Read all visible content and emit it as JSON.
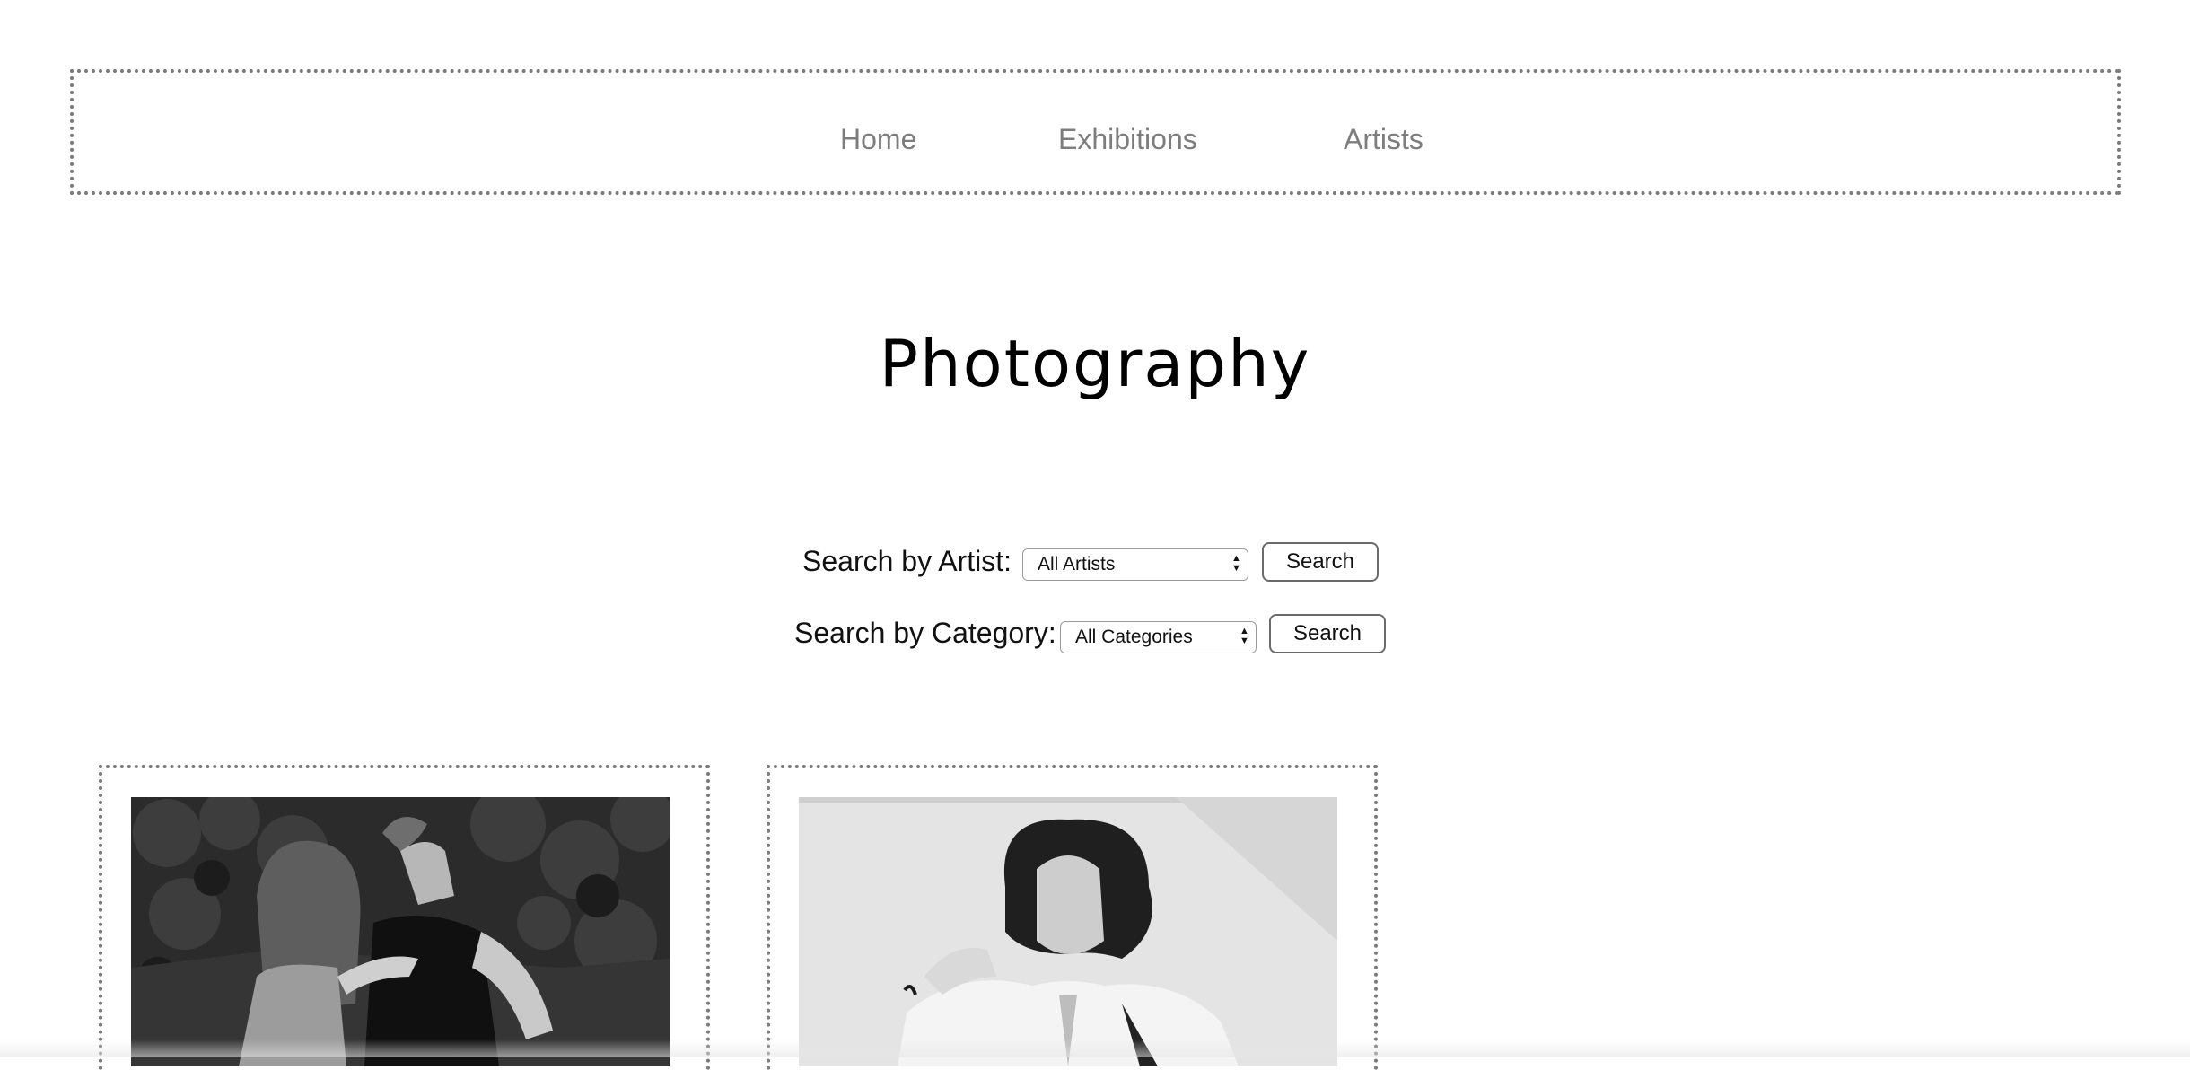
{
  "nav": {
    "home": "Home",
    "exhibitions": "Exhibitions",
    "artists": "Artists"
  },
  "page": {
    "title": "Photography"
  },
  "search": {
    "artist_label": "Search by Artist:",
    "artist_selected": "All Artists",
    "artist_button": "Search",
    "category_label": "Search by Category:",
    "category_selected": "All Categories",
    "category_button": "Search"
  },
  "gallery": {
    "items": [
      {
        "subject": "two women embracing outdoors, black and white"
      },
      {
        "subject": "portrait of a woman with dark curly hair, black and white"
      }
    ]
  },
  "colors": {
    "nav_text": "#7d7d7d",
    "border": "#7a7a7a",
    "title": "#000000"
  }
}
